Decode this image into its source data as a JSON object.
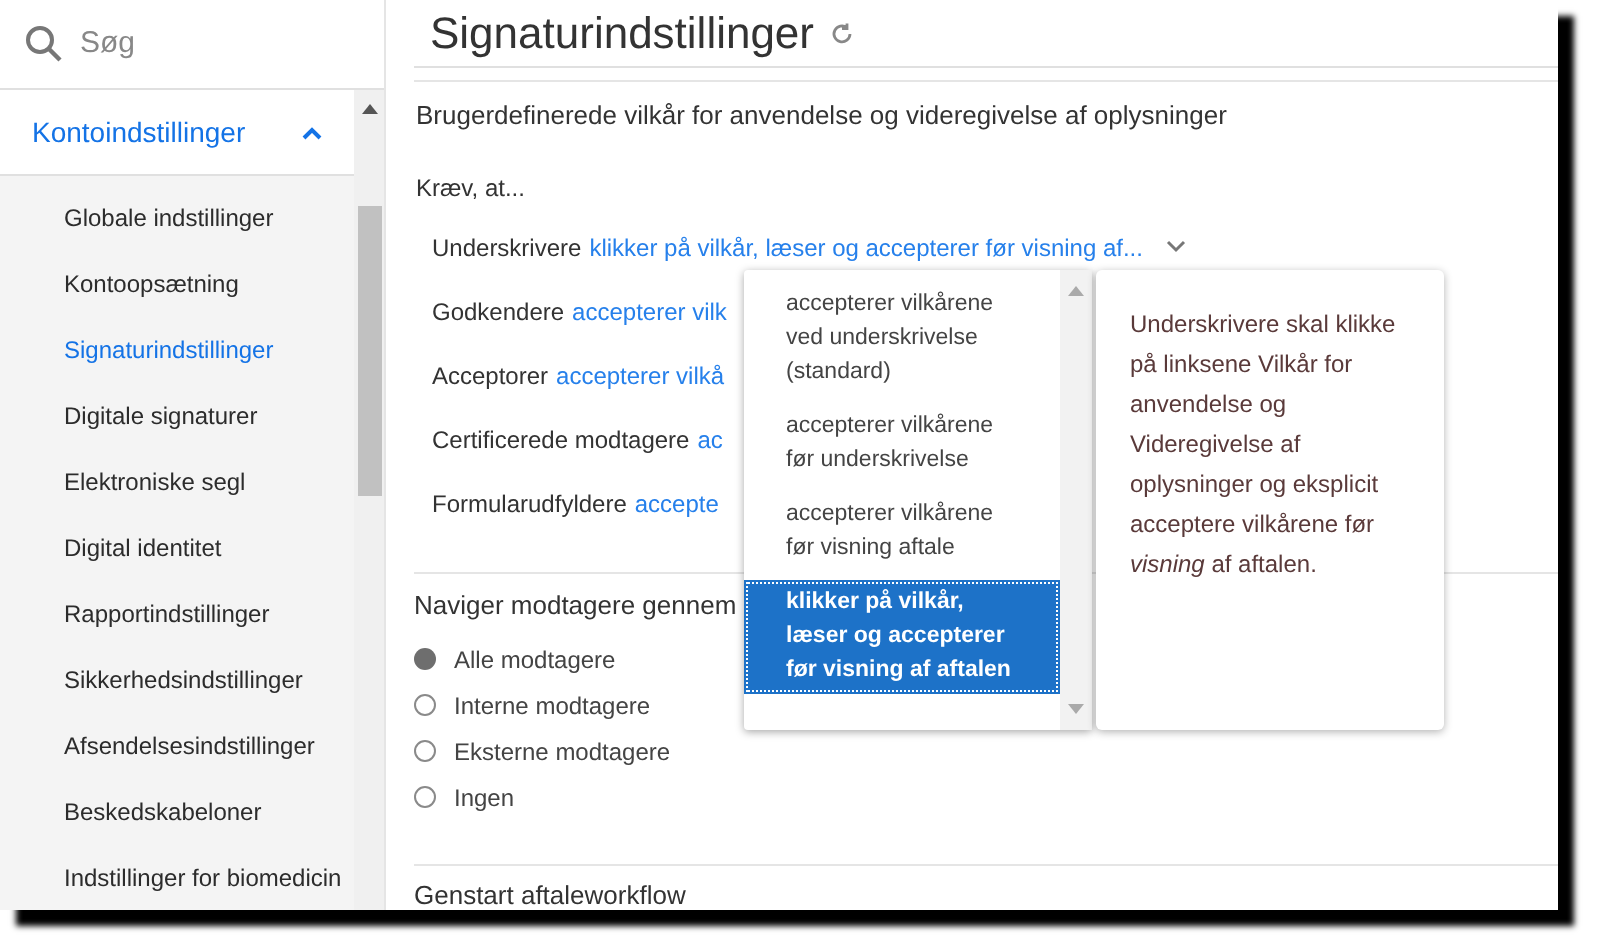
{
  "sidebar": {
    "search": {
      "placeholder": "Søg"
    },
    "section": {
      "label": "Kontoindstillinger",
      "expanded": true
    },
    "items": [
      {
        "label": "Globale indstillinger",
        "selected": false
      },
      {
        "label": "Kontoopsætning",
        "selected": false
      },
      {
        "label": "Signaturindstillinger",
        "selected": true
      },
      {
        "label": "Digitale signaturer",
        "selected": false
      },
      {
        "label": "Elektroniske segl",
        "selected": false
      },
      {
        "label": "Digital identitet",
        "selected": false
      },
      {
        "label": "Rapportindstillinger",
        "selected": false
      },
      {
        "label": "Sikkerhedsindstillinger",
        "selected": false
      },
      {
        "label": "Afsendelsesindstillinger",
        "selected": false
      },
      {
        "label": "Beskedskabeloner",
        "selected": false
      },
      {
        "label": "Indstillinger for biomedicin",
        "selected": false
      }
    ]
  },
  "page": {
    "title": "Signaturindstillinger",
    "terms_section": {
      "heading": "Brugerdefinerede vilkår for anvendelse og videregivelse af oplysninger",
      "require_label": "Kræv, at...",
      "rows": [
        {
          "role": "Underskrivere",
          "value": "klikker på vilkår, læser og accepterer før visning af..."
        },
        {
          "role": "Godkendere",
          "value": "accepterer vilk"
        },
        {
          "role": "Acceptorer",
          "value": "accepterer vilkå"
        },
        {
          "role": "Certificerede modtagere",
          "value": "ac"
        },
        {
          "role": "Formularudfyldere",
          "value": "accepte"
        }
      ]
    },
    "dropdown": {
      "options": [
        {
          "label": "accepterer vilkårene ved underskrivelse (standard)",
          "selected": false
        },
        {
          "label": "accepterer vilkårene før underskrivelse",
          "selected": false
        },
        {
          "label": "accepterer vilkårene før visning aftale",
          "selected": false
        },
        {
          "label": "klikker på vilkår, læser og accepterer før visning af aftalen",
          "selected": true
        }
      ]
    },
    "tooltip": "Underskrivere skal klikke på linksene Vilkår for anvendelse og Videregivelse af oplysninger og eksplicit acceptere vilkårene før *visning* af aftalen.",
    "navigate_section": {
      "heading": "Naviger modtagere gennem",
      "options": [
        {
          "label": "Alle modtagere",
          "selected": true
        },
        {
          "label": "Interne modtagere",
          "selected": false
        },
        {
          "label": "Eksterne modtagere",
          "selected": false
        },
        {
          "label": "Ingen",
          "selected": false
        }
      ]
    },
    "restart_section": {
      "heading": "Genstart aftaleworkflow"
    }
  }
}
